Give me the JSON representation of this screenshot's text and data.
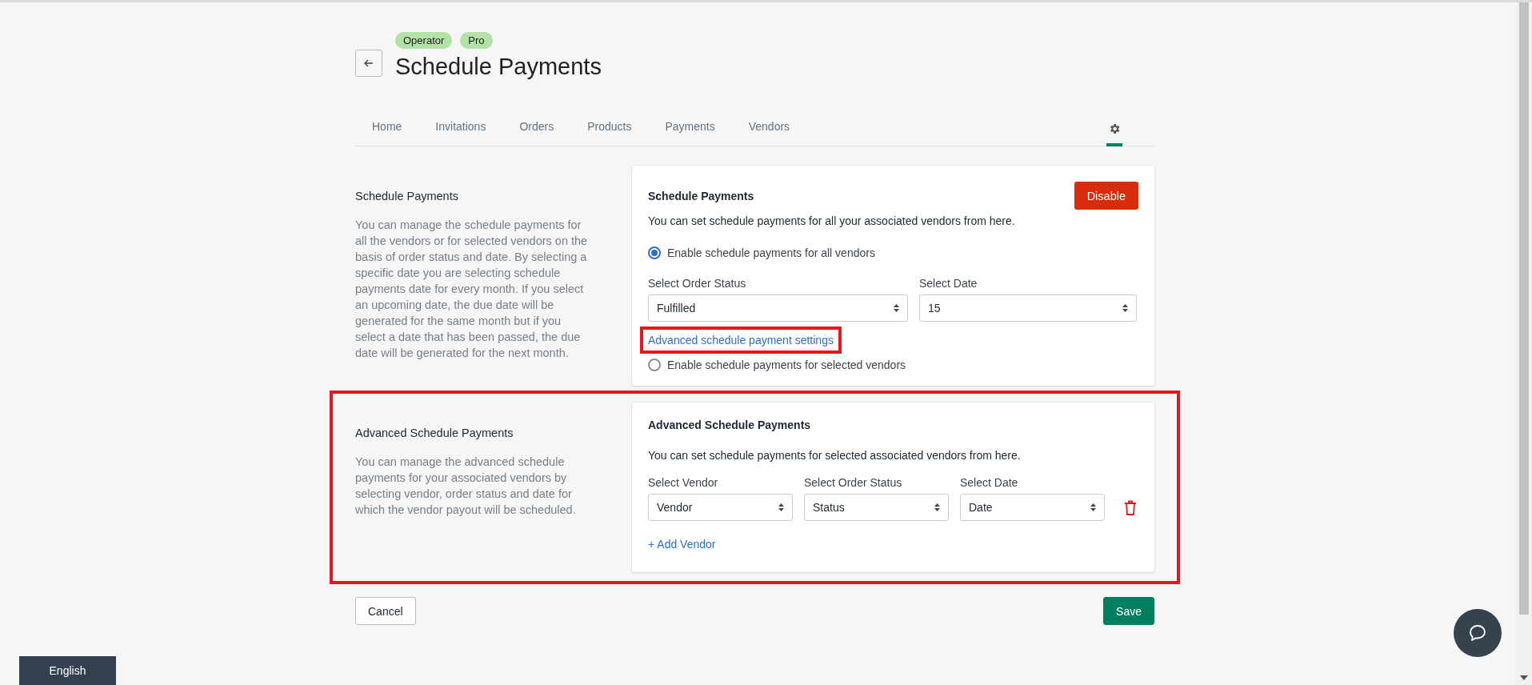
{
  "header": {
    "badges": [
      "Operator",
      "Pro"
    ],
    "title": "Schedule Payments"
  },
  "tabs": [
    {
      "label": "Home",
      "selected": false
    },
    {
      "label": "Invitations",
      "selected": false
    },
    {
      "label": "Orders",
      "selected": false
    },
    {
      "label": "Products",
      "selected": false
    },
    {
      "label": "Payments",
      "selected": false
    },
    {
      "label": "Vendors",
      "selected": false
    },
    {
      "kind": "settings",
      "selected": true
    }
  ],
  "sections": [
    {
      "kind": "general",
      "highlighted": false,
      "title": "Schedule Payments",
      "description": "You can manage the schedule payments for all the vendors or for selected vendors on the basis of order status and date. By selecting a specific date you are selecting schedule payments date for every month. If you select an upcoming date, the due date will be generated for the same month but if you select a date that has been passed, the due date will be generated for the next month.",
      "card": {
        "title": "Schedule Payments",
        "button": "Disable",
        "text": "You can set schedule payments for all your associated vendors from here.",
        "options": [
          {
            "label": "Enable schedule payments for all vendors",
            "selected": true
          },
          {
            "label": "Enable schedule payments for selected vendors",
            "selected": false
          }
        ],
        "selects": [
          {
            "label": "Select Order Status",
            "value": "Fulfilled"
          },
          {
            "label": "Select Date",
            "value": "15"
          }
        ],
        "link": {
          "text": "Advanced schedule payment settings",
          "highlighted": true
        }
      }
    },
    {
      "kind": "advanced",
      "highlighted": true,
      "title": "Advanced Schedule Payments",
      "description": "You can manage the advanced schedule payments for your associated vendors by selecting vendor, order status and date for which the vendor payout will be scheduled.",
      "card": {
        "title": "Advanced Schedule Payments",
        "text": "You can set schedule payments for selected associated vendors from here.",
        "selects": [
          {
            "label": "Select Vendor",
            "value": "Vendor"
          },
          {
            "label": "Select Order Status",
            "value": "Status"
          },
          {
            "label": "Select Date",
            "value": "Date"
          }
        ],
        "link": {
          "text": "+ Add Vendor",
          "highlighted": false
        }
      }
    }
  ],
  "footer": {
    "cancel": "Cancel",
    "save": "Save"
  },
  "language": "English"
}
